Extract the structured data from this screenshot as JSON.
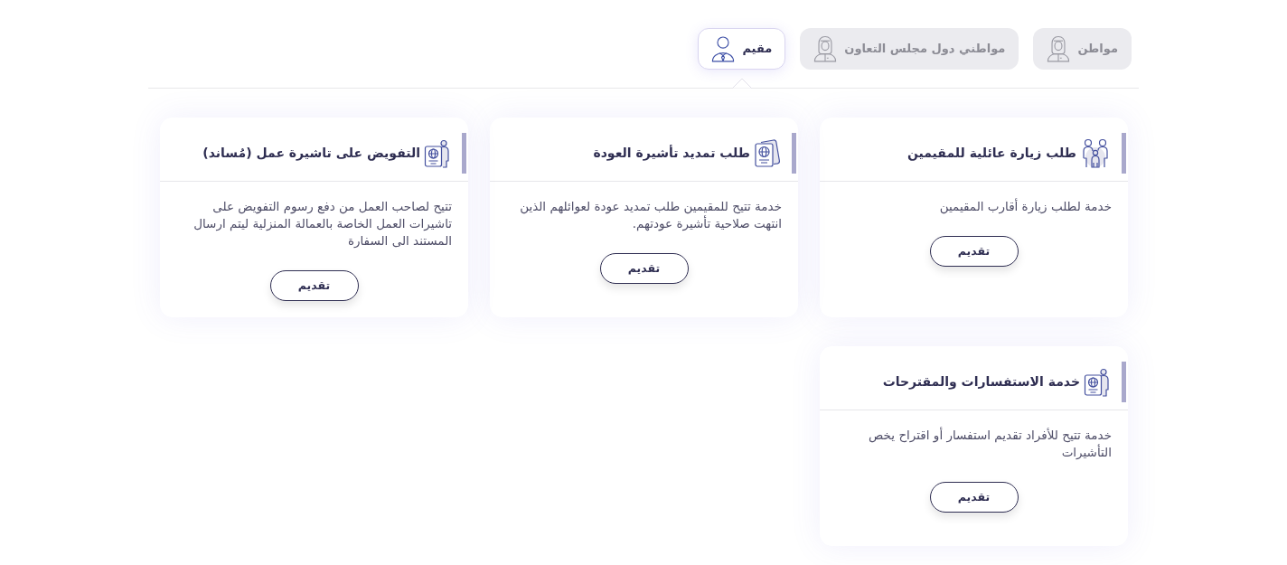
{
  "tabs": [
    {
      "label": "مواطن",
      "selected": false
    },
    {
      "label": "مواطني دول مجلس التعاون",
      "selected": false
    },
    {
      "label": "مقيم",
      "selected": true
    }
  ],
  "services": [
    {
      "title": "طلب زيارة عائلية للمقيمين",
      "description": "خدمة لطلب زيارة أقارب المقيمين",
      "button": "تقديم"
    },
    {
      "title": "طلب تمديد تأشيرة العودة",
      "description": "خدمة تتيح للمقيمين طلب تمديد عودة لعوائلهم الذين انتهت صلاحية تأشيرة عودتهم.",
      "button": "تقديم"
    },
    {
      "title": "التفويض على تاشيرة عمل (مُساند)",
      "description": "تتيح لصاحب العمل من دفع رسوم التفويض على تاشيرات العمل الخاصة بالعمالة المنزلية ليتم ارسال المستند الى السفارة",
      "button": "تقديم"
    },
    {
      "title": "خدمة الاستفسارات والمقترحات",
      "description": "خدمة تتيح للأفراد تقديم استفسار أو اقتراح يخص التأشيرات",
      "button": "تقديم"
    }
  ]
}
